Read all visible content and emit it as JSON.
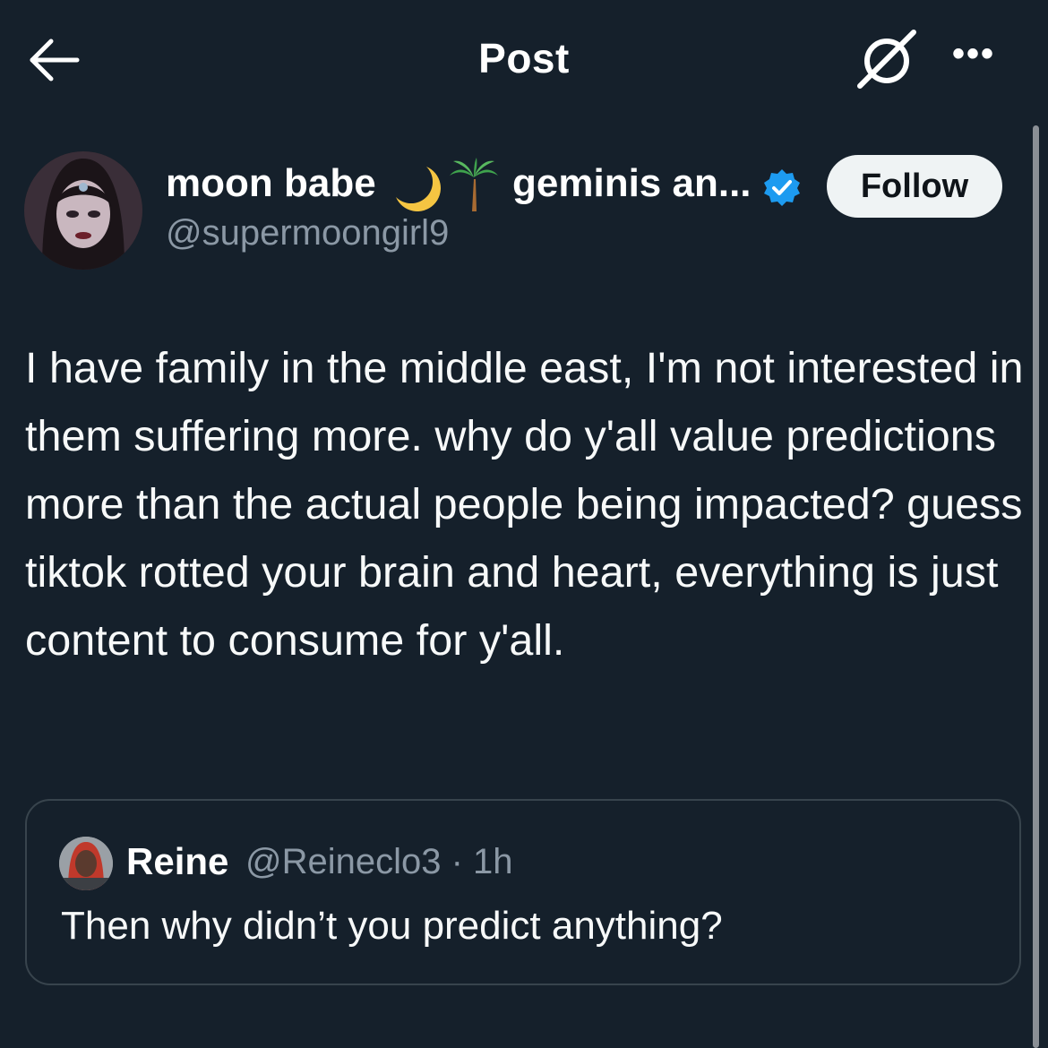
{
  "header": {
    "title": "Post",
    "back_icon": "arrow-left-icon",
    "grok_icon": "grok-icon",
    "more_label": "•••"
  },
  "author": {
    "name": "moon babe",
    "name_emoji": [
      "crescent-moon",
      "palm-tree"
    ],
    "name_tail": "geminis an...",
    "verified": true,
    "handle": "@supermoongirl9",
    "follow_label": "Follow"
  },
  "post": {
    "text": "I have family in the middle east, I'm not interested in them suffering more. why do y'all value predictions more than the actual people being impacted? guess tiktok rotted your brain and heart, everything is just content to consume for y'all."
  },
  "quoted_post": {
    "name": "Reine",
    "handle_time": "@Reineclo3 · 1h",
    "text": "Then why didn’t you predict anything?"
  },
  "colors": {
    "background": "#15202b",
    "text_primary": "#ffffff",
    "text_secondary": "#8b98a5",
    "verified_blue": "#1d9bf0",
    "border": "#38444d",
    "follow_bg": "#eff3f4"
  }
}
